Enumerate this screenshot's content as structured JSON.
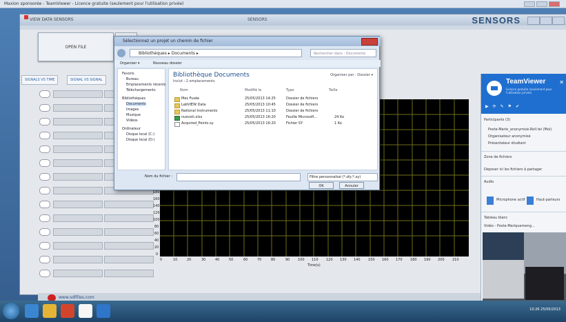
{
  "window": {
    "title": "Maxion sponsorée - TeamViewer - Licence gratuite (seulement pour l'utilisation privée)"
  },
  "app": {
    "title": "VIEW DATA SENSORS",
    "center_label": "SENSORS",
    "brand": "SENSORS",
    "open_file": "OPEN FILE",
    "tabs": [
      "SIGNALS VS TIME",
      "SIGNAL VS SIGNAL"
    ],
    "status_url": "www.sdifiles.com",
    "x_axis_label": "Time(s)",
    "x_ticks": [
      "0",
      "10",
      "20",
      "30",
      "40",
      "50",
      "60",
      "70",
      "80",
      "90",
      "100",
      "110",
      "120",
      "130",
      "140",
      "150",
      "160",
      "170",
      "180",
      "190",
      "200",
      "210"
    ],
    "y_ticks": [
      "180",
      "160",
      "140",
      "120",
      "100",
      "80",
      "60",
      "40",
      "20",
      "0"
    ]
  },
  "dialog": {
    "title": "Sélectionnez un projet un chemin de fichier",
    "address": "Bibliothèques ▸ Documents ▸",
    "search_placeholder": "Rechercher dans : Documents",
    "organize": "Organiser ▾",
    "new_folder": "Nouveau dossier",
    "nav_items": [
      "Favoris",
      "Bureau",
      "Emplacements récents",
      "Téléchargements",
      "Bibliothèques",
      "Documents",
      "Images",
      "Musique",
      "Vidéos",
      "Ordinateur",
      "Disque local (C:)",
      "Disque local (D:)"
    ],
    "library_title": "Bibliothèque Documents",
    "library_sub": "Inclut : 2 emplacements",
    "arrange": "Organiser par : Dossier ▾",
    "headers": [
      "Nom",
      "Modifié le",
      "Type",
      "Taille"
    ],
    "files": [
      {
        "name": "Mes Fusée",
        "date": "25/05/2013 14:25",
        "type": "Dossier de fichiers",
        "size": ""
      },
      {
        "name": "LabVIEW Data",
        "date": "25/05/2013 10:45",
        "type": "Dossier de fichiers",
        "size": ""
      },
      {
        "name": "National Instruments",
        "date": "25/05/2013 11:10",
        "type": "Dossier de fichiers",
        "size": ""
      },
      {
        "name": "nuevoti.xlsx",
        "date": "25/05/2013 16:20",
        "type": "Feuille Microsoft...",
        "size": "24 Ko"
      },
      {
        "name": "Acquired_Points.sy",
        "date": "25/05/2013 16:20",
        "type": "Fichier SY",
        "size": "1 Ko"
      }
    ],
    "filename_label": "Nom du fichier :",
    "filetype": "Filtre personnalisé (*.sfy;*.xy)",
    "ok": "OK",
    "cancel": "Annuler"
  },
  "teamviewer": {
    "name": "TeamViewer",
    "subtitle": "Licence gratuite (seulement pour l'utilisation privée)",
    "participants_header": "Participants (3)",
    "participants": [
      "Poste-Marie_anonymisé-Roll.tel (Moi)",
      "Organisateur anonymisé",
      "Présentateur étudiant"
    ],
    "files_section": "Zone de fichiers",
    "files_hint": "Déposer ici les fichiers à partager",
    "audio_section": "Audio",
    "audio_mic": "Microphone actif",
    "audio_speaker": "Haut-parleurs",
    "whiteboard": "Tableau blanc",
    "video_section": "Vidéo - Poste-Mariquemeng..."
  },
  "taskbar": {
    "time": "10:26",
    "date": "25/05/2013"
  }
}
